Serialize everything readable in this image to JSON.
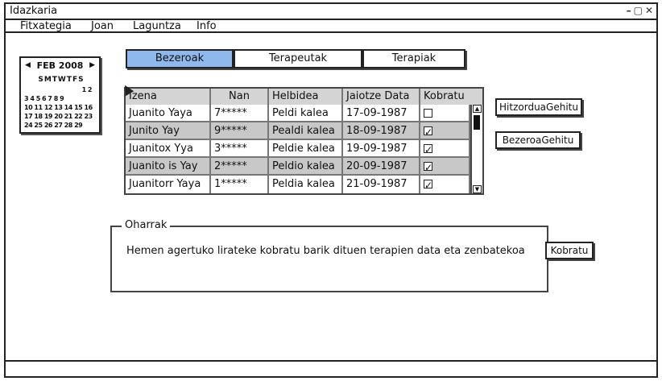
{
  "window": {
    "title": "Idazkaria",
    "controls": {
      "minimize": "–",
      "maximize": "▢",
      "close": "✕"
    }
  },
  "menu": [
    "Fitxategia",
    "Joan",
    "Laguntza",
    "Info"
  ],
  "calendar": {
    "month_label": "FEB 2008",
    "days_header": "SMTWTFS",
    "rows": [
      "           1 2",
      "3 4 5 6 7 8 9",
      "10 11 12 13 14 15 16",
      "17 18 19 20 21 22 23",
      "24 25 26 27 28 29"
    ]
  },
  "tabs": [
    {
      "label": "Bezeroak",
      "active": true
    },
    {
      "label": "Terapeutak",
      "active": false
    },
    {
      "label": "Terapiak",
      "active": false
    }
  ],
  "table": {
    "columns": [
      "Izena",
      "Nan",
      "Helbidea",
      "Jaiotze Data",
      "Kobratu"
    ],
    "rows": [
      {
        "izena": "Juanito Yaya",
        "nan": "7*****",
        "helbidea": "Peldi kalea",
        "data": "17-09-1987",
        "kobratu": false
      },
      {
        "izena": "Junito Yay",
        "nan": "9*****",
        "helbidea": "Pealdi kalea",
        "data": "18-09-1987",
        "kobratu": true
      },
      {
        "izena": "Juanitox Yya",
        "nan": "3*****",
        "helbidea": "Peldie kalea",
        "data": "19-09-1987",
        "kobratu": true
      },
      {
        "izena": "Juanito is Yay",
        "nan": "2*****",
        "helbidea": "Peldio kalea",
        "data": "20-09-1987",
        "kobratu": true
      },
      {
        "izena": "Juanitorr Yaya",
        "nan": "1*****",
        "helbidea": "Peldia kalea",
        "data": "21-09-1987",
        "kobratu": true
      }
    ]
  },
  "buttons": {
    "hitzordua": "HitzorduaGehitu",
    "bezeroa": "BezeroaGehitu",
    "kobratu": "Kobratu"
  },
  "notes": {
    "legend": "Oharrak",
    "text": "Hemen agertuko lirateke kobratu barik dituen terapien data eta zenbatekoa"
  },
  "colors": {
    "active_tab": "#8fb8ec",
    "alt_row": "#c8c8c8",
    "header": "#d4d4d4"
  }
}
